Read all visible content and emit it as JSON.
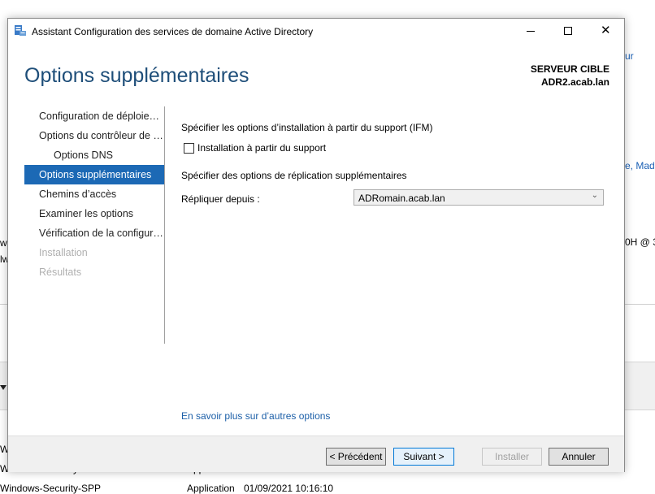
{
  "background": {
    "right_link_1": "ur",
    "right_link_2": "e, Madr",
    "right_text_3": "0H @ 3",
    "left_text_1": "w",
    "left_text_2": "lw",
    "row_1_col_1": "W",
    "row_2_col_1": "Windows-Security-SPP",
    "row_2_col_2": "Application",
    "row_3_col_1": "Windows-Security-SPP",
    "row_3_col_2": "Application",
    "row_3_col_3": "01/09/2021 10:16:10"
  },
  "window": {
    "title": "Assistant Configuration des services de domaine Active Directory",
    "minimize_glyph": "",
    "close_glyph": "✕"
  },
  "page": {
    "heading": "Options supplémentaires",
    "target_label": "SERVEUR CIBLE",
    "target_server": "ADR2.acab.lan"
  },
  "nav": {
    "items": [
      {
        "label": "Configuration de déploiement",
        "state": "normal"
      },
      {
        "label": "Options du contrôleur de domaine",
        "state": "normal"
      },
      {
        "label": "Options DNS",
        "state": "sub"
      },
      {
        "label": "Options supplémentaires",
        "state": "active"
      },
      {
        "label": "Chemins d’accès",
        "state": "normal"
      },
      {
        "label": "Examiner les options",
        "state": "normal"
      },
      {
        "label": "Vérification de la configuration requise",
        "state": "normal"
      },
      {
        "label": "Installation",
        "state": "disabled"
      },
      {
        "label": "Résultats",
        "state": "disabled"
      }
    ]
  },
  "main": {
    "ifm_section": "Spécifier les options d’installation à partir du support (IFM)",
    "ifm_checkbox_label": "Installation à partir du support",
    "ifm_checked": false,
    "replication_section": "Spécifier des options de réplication supplémentaires",
    "replicate_from_label": "Répliquer depuis :",
    "replicate_from_value": "ADRomain.acab.lan",
    "more_link": "En savoir plus sur d’autres options"
  },
  "footer": {
    "prev": "< Précédent",
    "next": "Suivant >",
    "install": "Installer",
    "cancel": "Annuler"
  },
  "colors": {
    "accent": "#1c69b5",
    "heading": "#1e4e79",
    "link": "#1c5fa8"
  }
}
